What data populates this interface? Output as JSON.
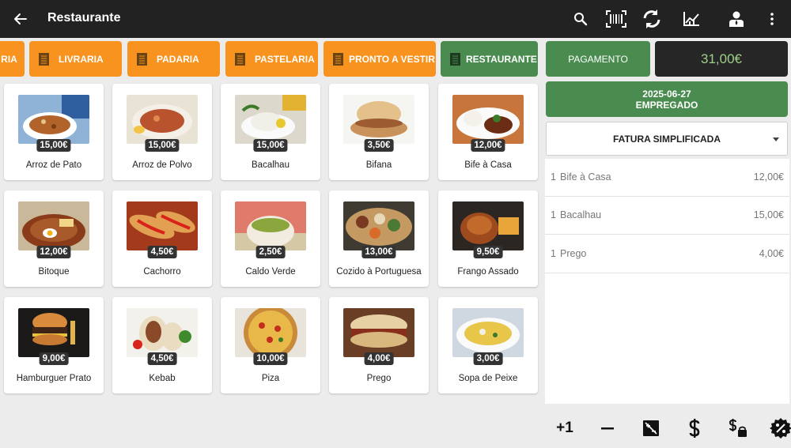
{
  "appbar": {
    "title": "Restaurante",
    "actions": [
      "search-icon",
      "barcode-icon",
      "sync-icon",
      "chart-icon",
      "user-icon",
      "more-vert-icon"
    ]
  },
  "categories": [
    {
      "label": "RIA",
      "color": "#f7931e"
    },
    {
      "label": "LIVRARIA",
      "color": "#f7931e"
    },
    {
      "label": "PADARIA",
      "color": "#f7931e"
    },
    {
      "label": "PASTELARIA",
      "color": "#f7931e"
    },
    {
      "label": "PRONTO A VESTIR",
      "color": "#f7931e"
    },
    {
      "label": "RESTAURANTE",
      "color": "#4a8c4f"
    }
  ],
  "products": [
    {
      "name": "Arroz de Pato",
      "price": "15,00€"
    },
    {
      "name": "Arroz de Polvo",
      "price": "15,00€"
    },
    {
      "name": "Bacalhau",
      "price": "15,00€"
    },
    {
      "name": "Bifana",
      "price": "3,50€"
    },
    {
      "name": "Bife à Casa",
      "price": "12,00€"
    },
    {
      "name": "Bitoque",
      "price": "12,00€"
    },
    {
      "name": "Cachorro",
      "price": "4,50€"
    },
    {
      "name": "Caldo Verde",
      "price": "2,50€"
    },
    {
      "name": "Cozido à Portuguesa",
      "price": "13,00€"
    },
    {
      "name": "Frango Assado",
      "price": "9,50€"
    },
    {
      "name": "Hamburguer Prato",
      "price": "9,00€"
    },
    {
      "name": "Kebab",
      "price": "4,50€"
    },
    {
      "name": "Piza",
      "price": "10,00€"
    },
    {
      "name": "Prego",
      "price": "4,00€"
    },
    {
      "name": "Sopa de Peixe",
      "price": "3,00€"
    }
  ],
  "order": {
    "pay_label": "PAGAMENTO",
    "total": "31,00€",
    "date": "2025-06-27",
    "employee": "EMPREGADO",
    "doc_type": "FATURA SIMPLIFICADA",
    "lines": [
      {
        "qty": "1",
        "desc": "Bife à Casa",
        "amount": "12,00€"
      },
      {
        "qty": "1",
        "desc": "Bacalhau",
        "amount": "15,00€"
      },
      {
        "qty": "1",
        "desc": "Prego",
        "amount": "4,00€"
      }
    ]
  },
  "toolbar": {
    "plus_one": "+1",
    "tools": [
      "minus-icon",
      "price-edit-icon",
      "dollar-icon",
      "price-tag-icon",
      "discount-icon"
    ]
  },
  "colors": {
    "topbar": "#222222",
    "orange": "#f7931e",
    "green": "#4a8c4f",
    "total_text": "#9ed08a"
  }
}
